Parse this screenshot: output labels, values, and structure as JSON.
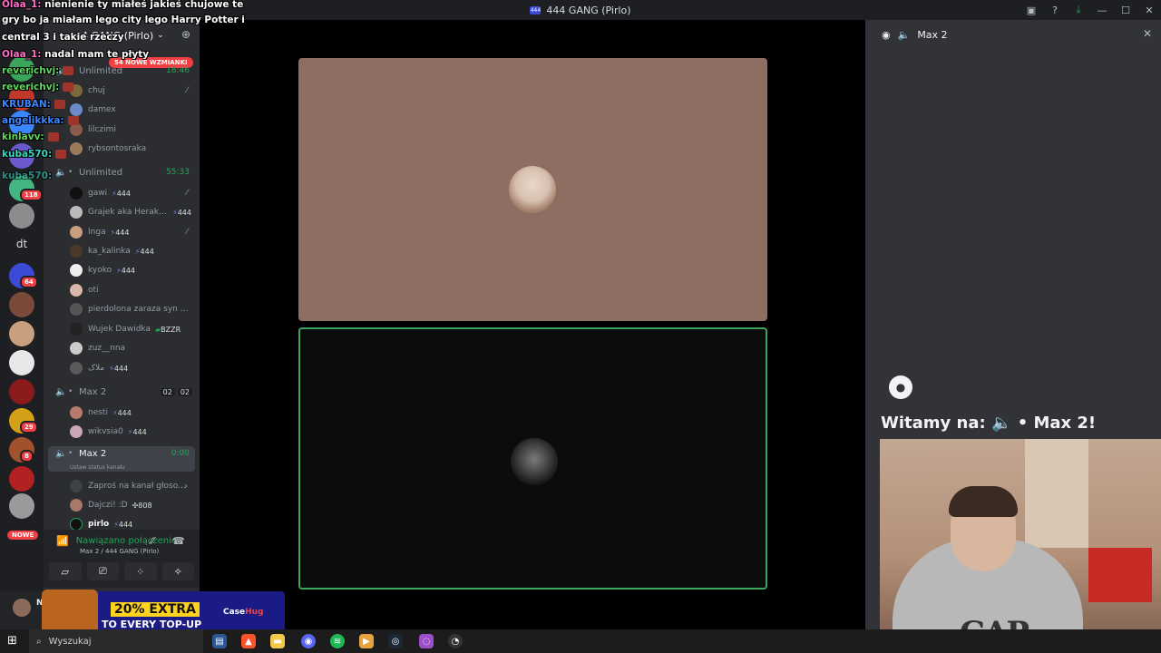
{
  "window": {
    "title": "444 GANG (Pirlo)"
  },
  "rail": {
    "dt_label": "dt",
    "badges": [
      "118",
      "64",
      "29",
      "8"
    ],
    "nowe_label": "NOWE"
  },
  "sidebar": {
    "server_name": "444 GANG (Pirlo)",
    "mentions_pill": "54 NOWE WZMIANKI",
    "channels": [
      {
        "name": "Unlimited",
        "timer": "18:46"
      },
      {
        "name": "Unlimited",
        "timer": "55:33"
      },
      {
        "name": "Max 2",
        "count1": "02",
        "count2": "02"
      },
      {
        "name": "Max 2",
        "timer": "0:00",
        "status": "Ustaw status kanału"
      }
    ],
    "group1_users": [
      "chuj",
      "damex",
      "lilczimi",
      "rybsontosraka"
    ],
    "group2_users": [
      {
        "name": "gawi",
        "tag": "444"
      },
      {
        "name": "Grajek aka Herakles",
        "tag": "444"
      },
      {
        "name": "Inga",
        "tag": "444"
      },
      {
        "name": "ka_kalinka",
        "tag": "444"
      },
      {
        "name": "kyoko",
        "tag": "444"
      },
      {
        "name": "oti",
        "tag": ""
      },
      {
        "name": "pierdolona zaraza syn sza...",
        "tag": ""
      },
      {
        "name": "Wujek Dawidka",
        "tag": "BZZR"
      },
      {
        "name": "zuz__nna",
        "tag": ""
      },
      {
        "name": "ملاک",
        "tag": "444"
      }
    ],
    "group3_users": [
      {
        "name": "nesti",
        "tag": "444"
      },
      {
        "name": "wikvsia0",
        "tag": "444"
      }
    ],
    "invite_label": "Zaproś na kanał głoso...",
    "group4_users": [
      {
        "name": "Dajczi! :D",
        "tag": "808"
      },
      {
        "name": "pirlo",
        "tag": "444"
      }
    ]
  },
  "voice": {
    "status": "Nawiązano połączenie",
    "location": "Max 2 / 444 GANG (Pirlo)"
  },
  "userbar": {
    "name": "NK"
  },
  "chat_overlay": [
    {
      "who": "Olaa_1:",
      "msg": " nienienie ty miałeś jakieś chujowe te",
      "color": "who-pink"
    },
    {
      "who": "",
      "msg": "gry bo ja miałam lego city lego Harry Potter i",
      "color": ""
    },
    {
      "who": "",
      "msg": "central 3 i takie rzeczy",
      "color": ""
    },
    {
      "who": "Olaa_1:",
      "msg": " nadal mam te płyty",
      "color": "who-pink"
    },
    {
      "who": "reverichvj:",
      "msg": "",
      "color": "who-green"
    },
    {
      "who": "reverichvj:",
      "msg": "",
      "color": "who-green"
    },
    {
      "who": "KRUBAN:",
      "msg": "",
      "color": "who-blue"
    },
    {
      "who": "angelikkka:",
      "msg": "",
      "color": "who-blue"
    },
    {
      "who": "kinlavv:",
      "msg": "",
      "color": "who-green"
    },
    {
      "who": "kuba570:",
      "msg": "",
      "color": "who-aqua"
    },
    {
      "who": "kuba570:",
      "msg": "",
      "color": "who-aqua"
    }
  ],
  "right_panel": {
    "header": "Max 2",
    "welcome_prefix": "Witamy na:",
    "welcome_channel": "• Max 2!",
    "webcam_print": "GAP"
  },
  "ad": {
    "headline": "20% EXTRA",
    "subline": "TO EVERY TOP-UP",
    "brand_a": "Case",
    "brand_b": "Hug"
  },
  "taskbar": {
    "search_placeholder": "Wyszukaj"
  }
}
